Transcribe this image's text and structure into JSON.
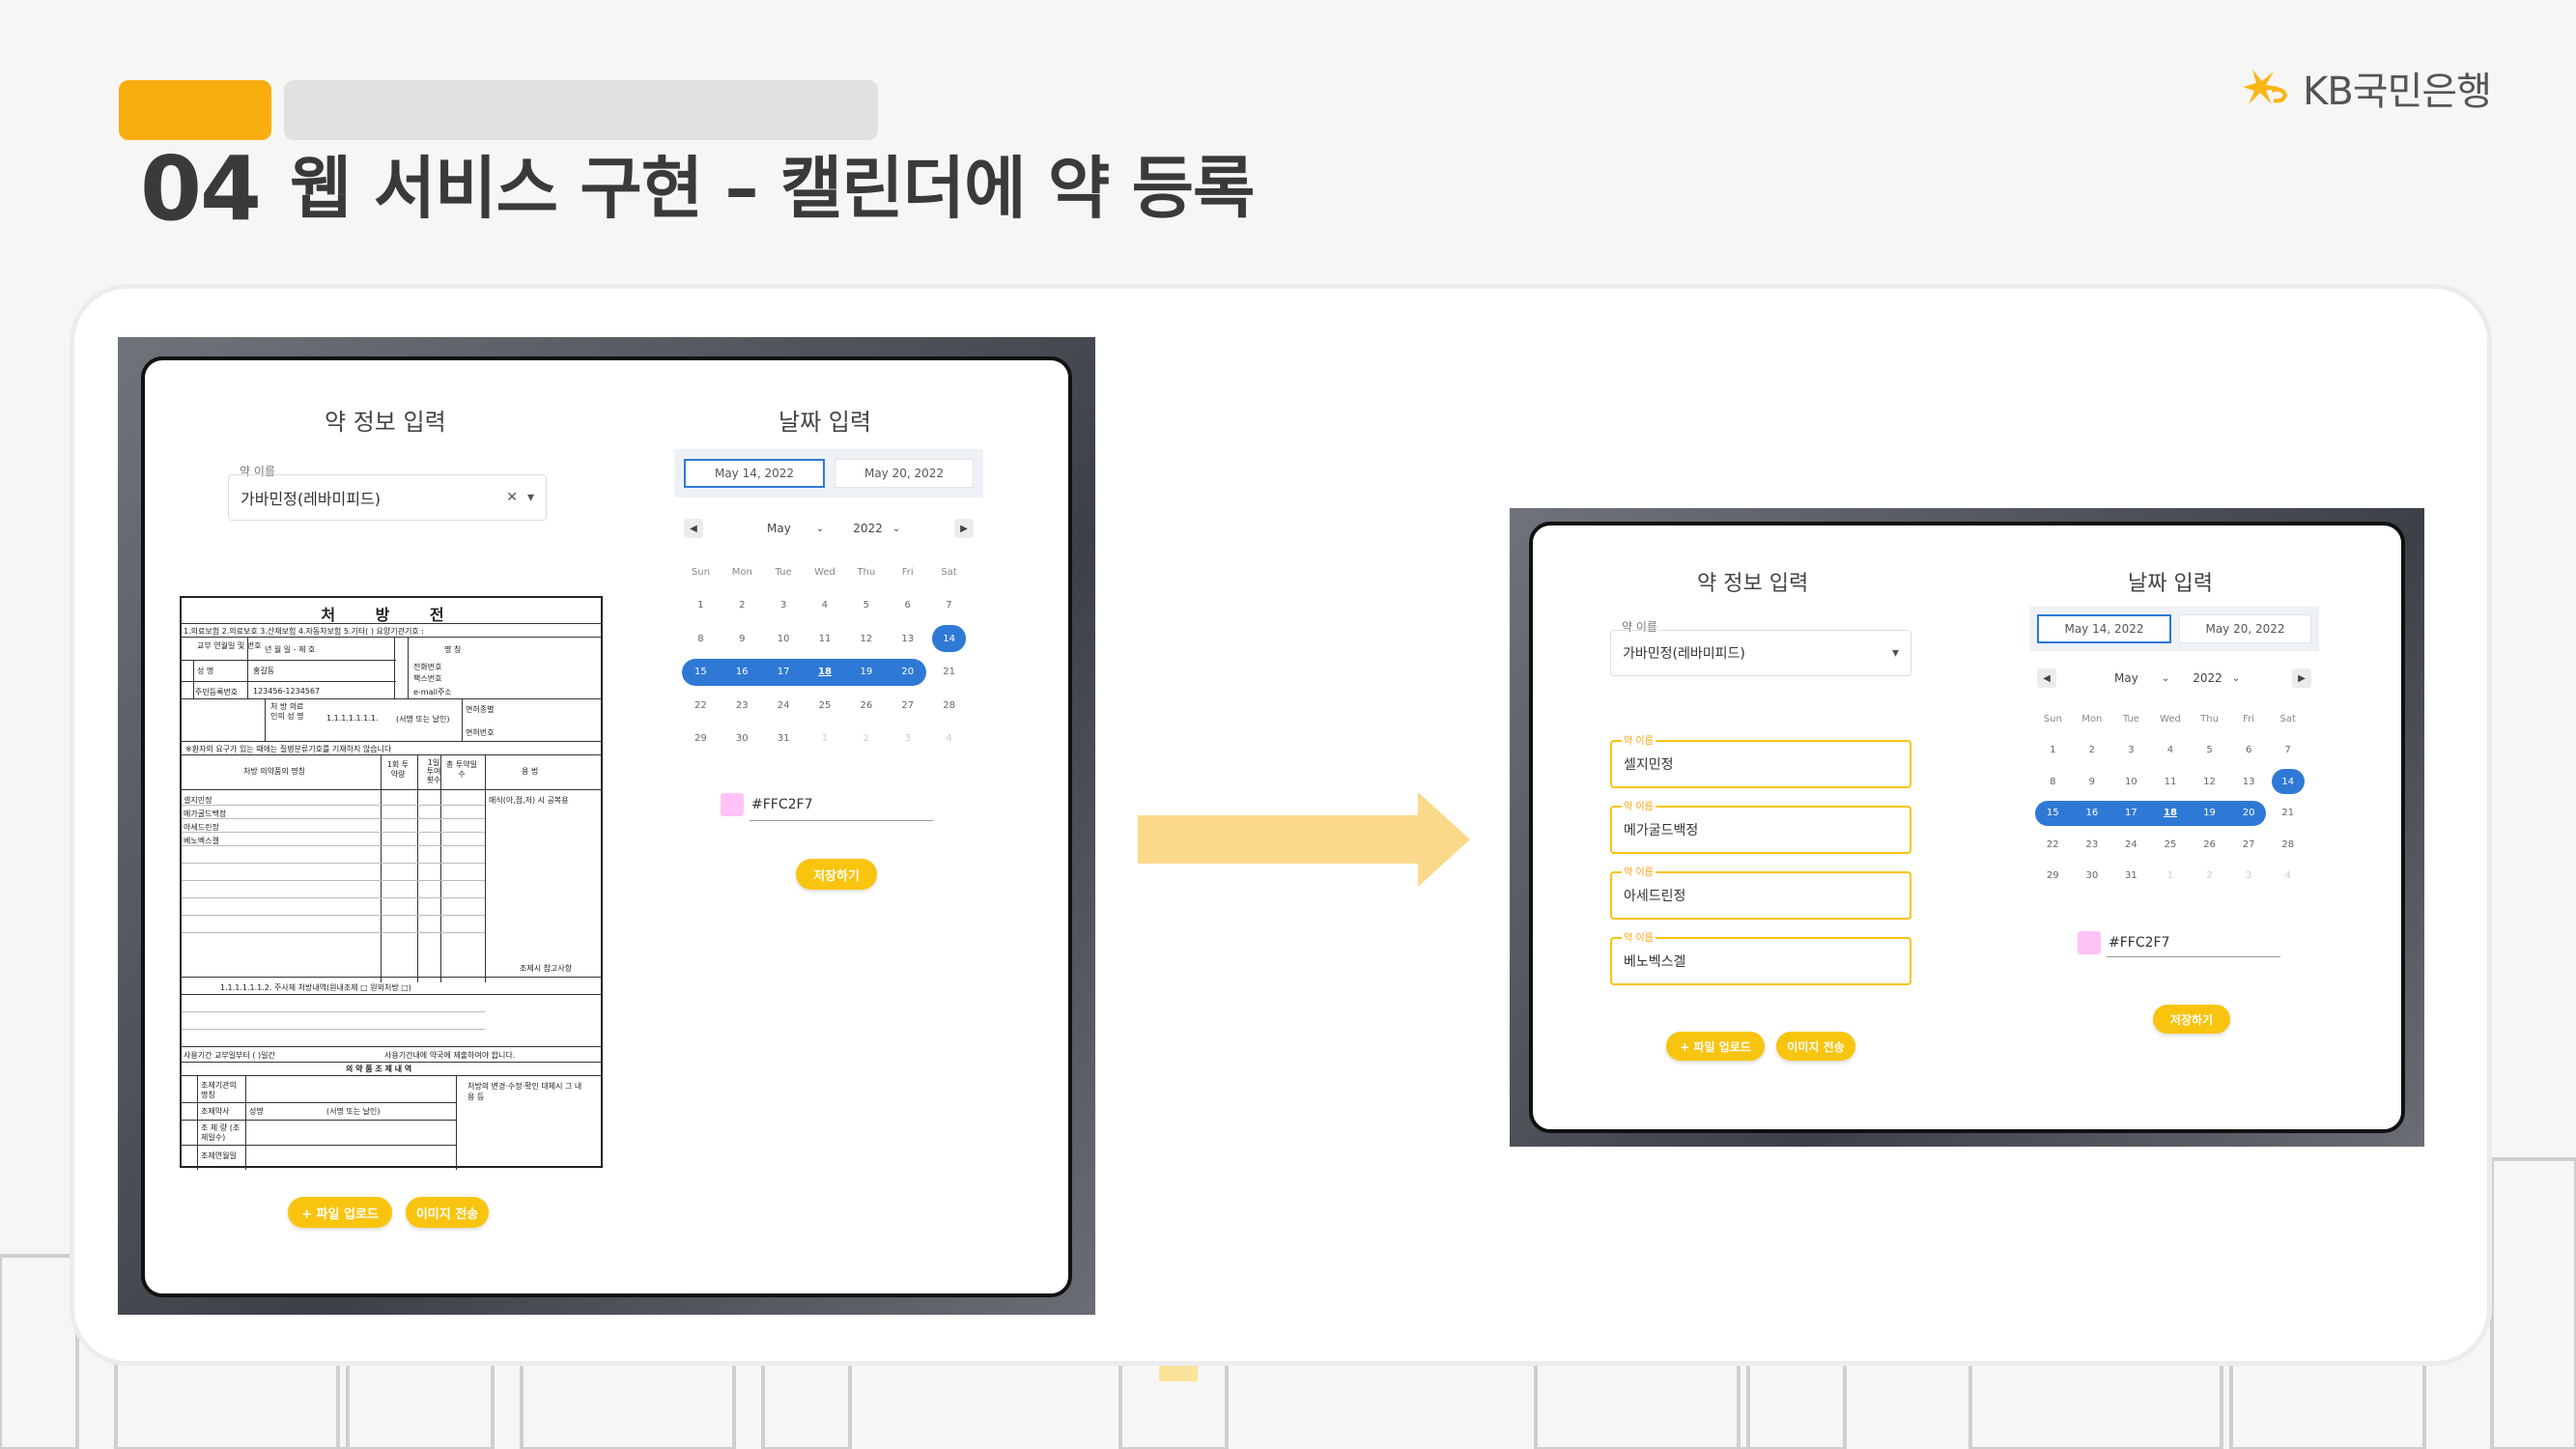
{
  "header": {
    "slide_number": "04",
    "title": "웹 서비스 구현 – 캘린더에 약 등록",
    "brand": "KB국민은행"
  },
  "colors": {
    "accent": "#f9ad0f",
    "button": "#f9c40f",
    "selected": "#2f79d6",
    "swatch": "#FFC2F7"
  },
  "left": {
    "med_panel_title": "약 정보 입력",
    "med_label": "약 이름",
    "med_value": "가바민정(레바미피드)",
    "date_panel_title": "날짜 입력",
    "start_date": "May 14, 2022",
    "end_date": "May 20, 2022",
    "month": "May",
    "year": "2022",
    "color_value": "#FFC2F7",
    "save_label": "저장하기",
    "upload_label": "+ 파일 업로드",
    "send_label": "이미지 전송",
    "rx": {
      "title": "처 방 전",
      "insurance": "1.의료보험 2.의료보호 3.산재보험 4.자동차보험 5.기타(    ) 요양기관기호 :",
      "issue_date": "교부 연월일 및 번호",
      "ymd": "년  월  일 - 제   호",
      "name_label": "성 명",
      "name_value": "홍길동",
      "id_label": "주민등록번호",
      "id_value": "123456-1234567",
      "inst_label": "명 칭",
      "tel_label": "전화번호",
      "fax_label": "팩스번호",
      "email_label": "e-mail주소",
      "doctor_label": "처 방 의료인의 성 명",
      "doctor_value": "1.1.1.1.1.1.1.",
      "sign": "(서명 또는 날인)",
      "license": "면허종별",
      "license_no": "면허번호",
      "notice": "※환자의 요구가 있는 때에는 질병분류기호를 기재하지 않습니다",
      "col_name": "처방 의약품의 명칭",
      "col_dose": "1회 투약량",
      "col_times": "1일 투여 횟수",
      "col_days": "총 투약일수",
      "col_usage": "용  법",
      "drugs": [
        "셀지민정",
        "메가굴드백정",
        "아세드린정",
        "베노벡스겔"
      ],
      "usage_value": "매식(아,점,저) 시  공복용",
      "ref_label": "조제시 참고사항",
      "injection": "1.1.1.1.1.1.2.  주사제 처방내역(원내조제 □  원외처방 □)",
      "period": "사용기간  교부일부터 (       )일간",
      "period_note": "사용기간내에 약국에 제출하여야 합니다.",
      "dispense_title": "의 약 품  조 제 내 역",
      "dispense_inst": "조제기관의 명칭",
      "pharmacist": "조제약사",
      "pharmacist_name": "성명",
      "amount": "조 제 량 (조제일수)",
      "dispense_date": "조제연월일",
      "change_note": "처방의 변경·수정·확인 대체시 그 내용 등"
    }
  },
  "right": {
    "med_panel_title": "약 정보 입력",
    "med_label": "약 이름",
    "med_value": "가바민정(레바미피드)",
    "fields": [
      {
        "label": "약 이름",
        "value": "셀지민정"
      },
      {
        "label": "약 이름",
        "value": "메가굴드백정"
      },
      {
        "label": "약 이름",
        "value": "아세드린정"
      },
      {
        "label": "약 이름",
        "value": "베노벡스겔"
      }
    ],
    "upload_label": "+ 파일 업로드",
    "send_label": "이미지 전송",
    "date_panel_title": "날짜 입력",
    "start_date": "May 14, 2022",
    "end_date": "May 20, 2022",
    "month": "May",
    "year": "2022",
    "color_value": "#FFC2F7",
    "save_label": "저장하기"
  },
  "calendar": {
    "weekdays": [
      "Sun",
      "Mon",
      "Tue",
      "Wed",
      "Thu",
      "Fri",
      "Sat"
    ],
    "days": [
      "1",
      "2",
      "3",
      "4",
      "5",
      "6",
      "7",
      "8",
      "9",
      "10",
      "11",
      "12",
      "13",
      "14",
      "15",
      "16",
      "17",
      "18",
      "19",
      "20",
      "21",
      "22",
      "23",
      "24",
      "25",
      "26",
      "27",
      "28",
      "29",
      "30",
      "31",
      "1",
      "2",
      "3",
      "4"
    ],
    "range_start": 14,
    "range_end": 20,
    "today": 18
  }
}
